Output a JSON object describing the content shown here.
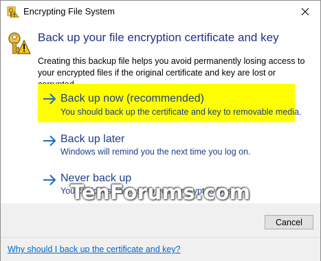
{
  "window": {
    "title": "Encrypting File System",
    "title_icon": "efs-key-icon",
    "close_icon": "close-icon"
  },
  "content": {
    "header_icon": "key-warning-icon",
    "heading": "Back up your file encryption certificate and key",
    "description": "Creating this backup file helps you avoid permanently losing access to your encrypted files if the original certificate and key are lost or corrupted.",
    "options": [
      {
        "label": "Back up now (recommended)",
        "sub": "You should back up the certificate and key to removable media.",
        "highlighted": true
      },
      {
        "label": "Back up later",
        "sub": "Windows will remind you the next time you log on.",
        "highlighted": false
      },
      {
        "label": "Never back up",
        "sub": "You could lose access to your encrypted files.",
        "highlighted": false
      }
    ],
    "arrow_icon": "arrow-right-icon"
  },
  "watermark": "TenForums.com",
  "buttons": {
    "cancel": "Cancel"
  },
  "footer": {
    "help_link": "Why should I back up the certificate and key?"
  },
  "colors": {
    "heading": "#1e3287",
    "option_text": "#1c3e8a",
    "highlight": "#ffff00",
    "link": "#0066cc",
    "band": "#f0f0f0"
  }
}
